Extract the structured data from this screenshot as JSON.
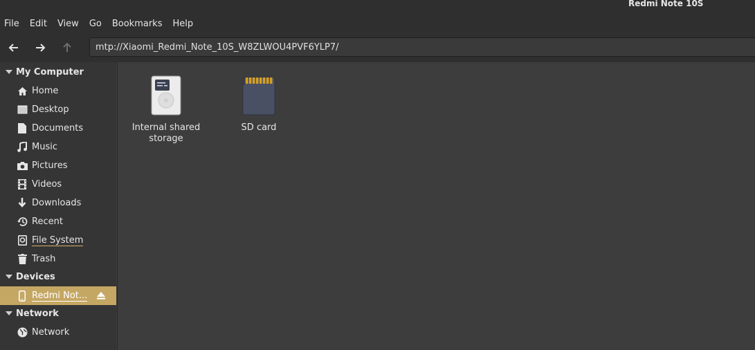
{
  "window": {
    "title": "Redmi Note 10S"
  },
  "menu": [
    "File",
    "Edit",
    "View",
    "Go",
    "Bookmarks",
    "Help"
  ],
  "location": {
    "path": "mtp://Xiaomi_Redmi_Note_10S_W8ZLWOU4PVF6YLP7/"
  },
  "sidebar": {
    "sections": {
      "my_computer": "My Computer",
      "devices": "Devices",
      "network": "Network"
    },
    "items": [
      {
        "label": "Home",
        "icon": "home-icon"
      },
      {
        "label": "Desktop",
        "icon": "desktop-icon"
      },
      {
        "label": "Documents",
        "icon": "document-icon"
      },
      {
        "label": "Music",
        "icon": "music-icon"
      },
      {
        "label": "Pictures",
        "icon": "camera-icon"
      },
      {
        "label": "Videos",
        "icon": "film-icon"
      },
      {
        "label": "Downloads",
        "icon": "download-icon"
      },
      {
        "label": "Recent",
        "icon": "history-icon"
      },
      {
        "label": "File System",
        "icon": "drive-icon"
      },
      {
        "label": "Trash",
        "icon": "trash-icon"
      }
    ],
    "device": {
      "label": "Redmi Not...",
      "icon": "phone-icon",
      "eject_icon": "eject-icon"
    },
    "network_item": {
      "label": "Network",
      "icon": "globe-icon"
    }
  },
  "files": [
    {
      "line1": "Internal shared",
      "line2": "storage",
      "icon": "internal-storage-icon"
    },
    {
      "line1": "SD card",
      "line2": "",
      "icon": "sd-card-icon"
    }
  ],
  "colors": {
    "accent": "#c5a764",
    "sidebar_bg": "#353535",
    "main_bg": "#3d3d3d"
  }
}
